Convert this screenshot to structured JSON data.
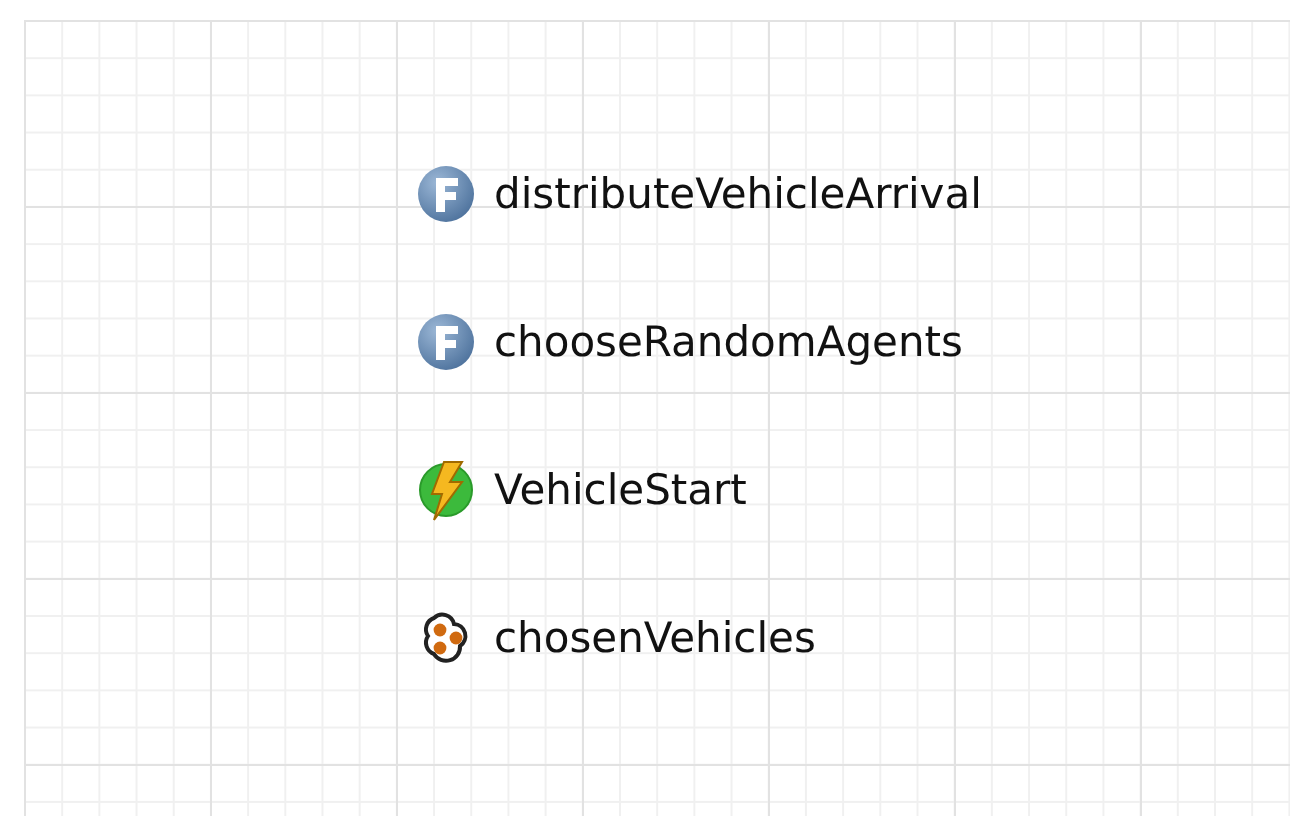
{
  "elements": [
    {
      "kind": "function",
      "name": "distributeVehicleArrival"
    },
    {
      "kind": "function",
      "name": "chooseRandomAgents"
    },
    {
      "kind": "event",
      "name": "VehicleStart"
    },
    {
      "kind": "collection",
      "name": "chosenVehicles"
    }
  ]
}
